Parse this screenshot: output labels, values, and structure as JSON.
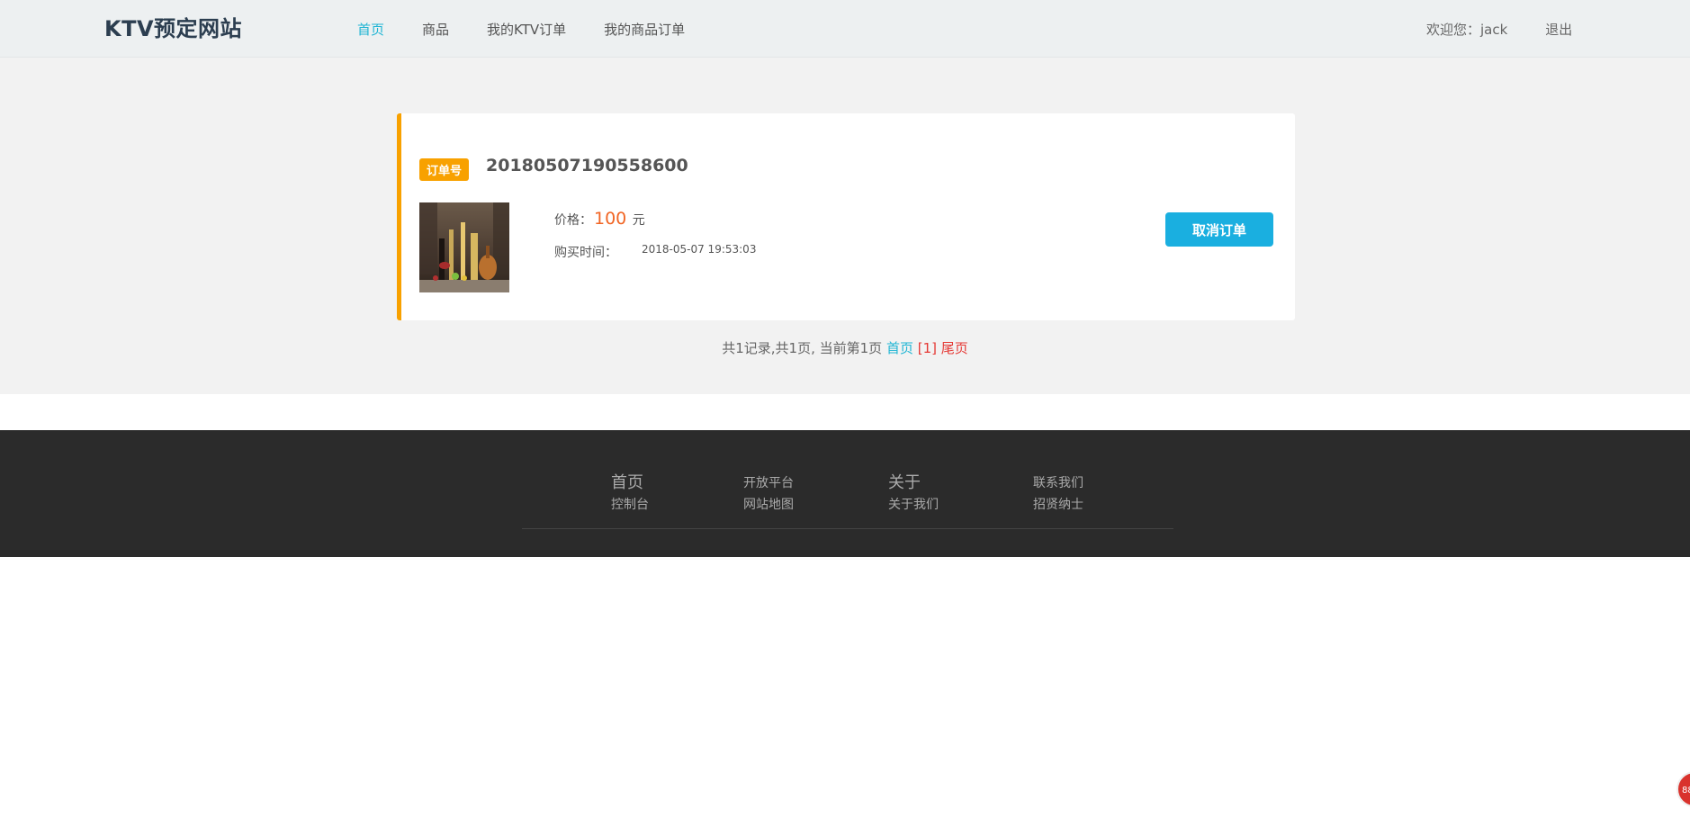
{
  "header": {
    "brand": "KTV预定网站",
    "nav": [
      "首页",
      "商品",
      "我的KTV订单",
      "我的商品订单"
    ],
    "welcome": "欢迎您：jack",
    "logout": "退出"
  },
  "order": {
    "tag": "订单号",
    "number": "20180507190558600",
    "price_label": "价格：",
    "price_value": "100",
    "price_unit": "元",
    "time_label": "购买时间：",
    "time_value": "2018-05-07 19:53:03",
    "cancel_button": "取消订单"
  },
  "pager": {
    "summary": "共1记录,共1页, 当前第1页",
    "first": "首页",
    "page": "[1]",
    "last": "尾页"
  },
  "footer": {
    "col1": {
      "top": "首页",
      "bottom": "控制台"
    },
    "col2": {
      "top": "开放平台",
      "bottom": "网站地图"
    },
    "col3": {
      "top": "关于",
      "bottom": "关于我们"
    },
    "col4": {
      "top": "联系我们",
      "bottom": "招贤纳士"
    }
  },
  "badge": "88",
  "colors": {
    "accent": "#1fb5d4",
    "order_tag": "#f8a100",
    "price": "#f16524",
    "button": "#1aafe0",
    "pager_red": "#e53935",
    "footer_bg": "#2b2b2b"
  }
}
